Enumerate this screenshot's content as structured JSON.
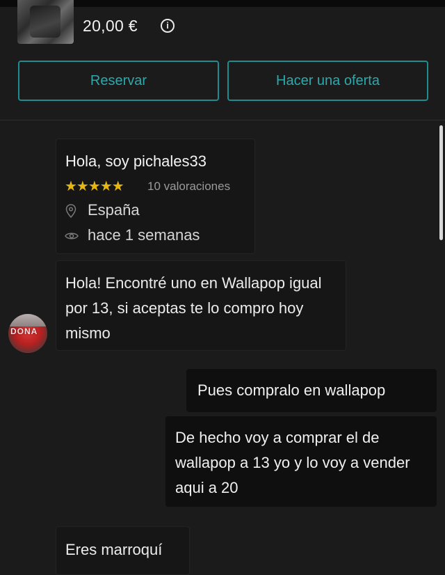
{
  "listing": {
    "price": "20,00 €",
    "info_icon": "info-circle-icon"
  },
  "actions": {
    "reserve_label": "Reservar",
    "offer_label": "Hacer una oferta",
    "accent_color": "#1f8d90"
  },
  "seller": {
    "greeting": "Hola, soy pichales33",
    "stars": "★★★★★",
    "rating_count": "10 valoraciones",
    "location": "España",
    "last_seen": "hace 1 semanas",
    "star_color": "#e7b711"
  },
  "messages": [
    {
      "from": "other",
      "text": "Hola! Encontré uno en Wallapop igual por 13, si aceptas te lo compro hoy mismo"
    },
    {
      "from": "me",
      "text": "Pues compralo en wallapop"
    },
    {
      "from": "me",
      "text": "De hecho voy a comprar el de wallapop a 13 yo y lo voy a vender aqui a 20"
    },
    {
      "from": "other",
      "text": "Eres marroquí"
    }
  ],
  "avatar": {
    "label": "DONA"
  }
}
